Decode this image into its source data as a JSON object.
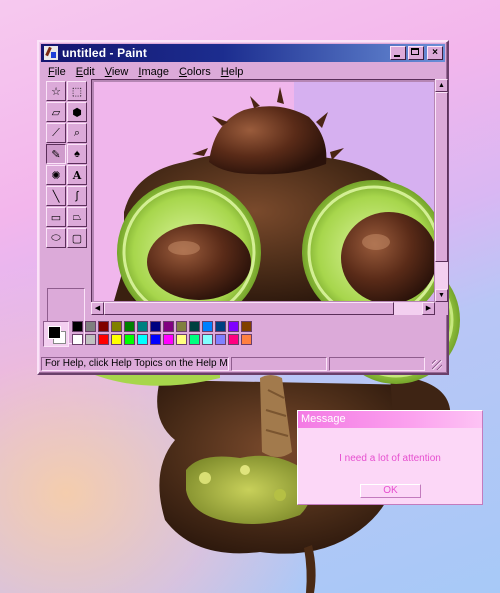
{
  "window": {
    "title": "untitled - Paint",
    "controls": {
      "minimize": "minimize",
      "maximize": "maximize",
      "close": "×"
    }
  },
  "menu": [
    {
      "underline": "F",
      "rest": "ile"
    },
    {
      "underline": "E",
      "rest": "dit"
    },
    {
      "underline": "V",
      "rest": "iew"
    },
    {
      "underline": "I",
      "rest": "mage"
    },
    {
      "underline": "C",
      "rest": "olors"
    },
    {
      "underline": "H",
      "rest": "elp"
    }
  ],
  "tools": [
    {
      "name": "free-form-select",
      "glyph": "☆"
    },
    {
      "name": "select",
      "glyph": "⬚"
    },
    {
      "name": "eraser",
      "glyph": "▱"
    },
    {
      "name": "fill-with-color",
      "glyph": "⬢"
    },
    {
      "name": "pick-color",
      "glyph": "⟋"
    },
    {
      "name": "magnifier",
      "glyph": "⌕"
    },
    {
      "name": "pencil",
      "glyph": "✎"
    },
    {
      "name": "brush",
      "glyph": "♠"
    },
    {
      "name": "airbrush",
      "glyph": "✺"
    },
    {
      "name": "text",
      "glyph": "A"
    },
    {
      "name": "line",
      "glyph": "╲"
    },
    {
      "name": "curve",
      "glyph": "∫"
    },
    {
      "name": "rectangle",
      "glyph": "▭"
    },
    {
      "name": "polygon",
      "glyph": "⏢"
    },
    {
      "name": "ellipse",
      "glyph": "⬭"
    },
    {
      "name": "rounded-rectangle",
      "glyph": "▢"
    }
  ],
  "palette": {
    "foreground": "#000000",
    "background": "#ffffff",
    "top_row": [
      "#000000",
      "#7f7f7f",
      "#800000",
      "#808000",
      "#008000",
      "#008080",
      "#000080",
      "#800080",
      "#808040",
      "#004040",
      "#0080ff",
      "#004080",
      "#8000ff",
      "#804000"
    ],
    "bottom_row": [
      "#ffffff",
      "#c0c0c0",
      "#ff0000",
      "#ffff00",
      "#00ff00",
      "#00ffff",
      "#0000ff",
      "#ff00ff",
      "#ffff80",
      "#00ff80",
      "#80ffff",
      "#8080ff",
      "#ff0080",
      "#ff8040"
    ]
  },
  "status": {
    "help_text": "For Help, click Help Topics on the Help Menu."
  },
  "message_box": {
    "title": "Message",
    "text": "I need a lot of attention",
    "ok_label": "OK"
  }
}
